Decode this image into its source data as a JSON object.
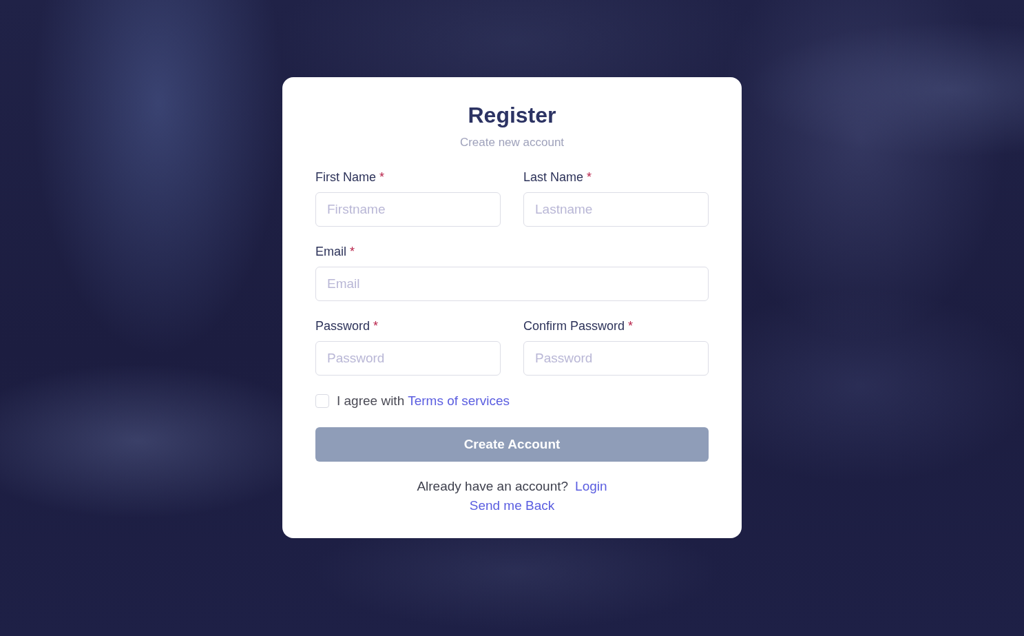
{
  "card": {
    "title": "Register",
    "subtitle": "Create new account",
    "rows": [
      {
        "fields": [
          {
            "label": "First Name",
            "required_mark": "*",
            "placeholder": "Firstname"
          },
          {
            "label": "Last Name",
            "required_mark": "*",
            "placeholder": "Lastname"
          }
        ]
      },
      {
        "fields": [
          {
            "label": "Email",
            "required_mark": "*",
            "placeholder": "Email"
          }
        ]
      },
      {
        "fields": [
          {
            "label": "Password",
            "required_mark": "*",
            "placeholder": "Password"
          },
          {
            "label": "Confirm Password",
            "required_mark": "*",
            "placeholder": "Password"
          }
        ]
      }
    ],
    "terms": {
      "checked": false,
      "text": "I agree with",
      "link": "Terms of services"
    },
    "submit_button": {
      "label": "Create Account",
      "disabled": true
    },
    "footer": {
      "prompt": "Already have an account?",
      "login_link": "Login",
      "back_link": "Send me Back"
    }
  }
}
